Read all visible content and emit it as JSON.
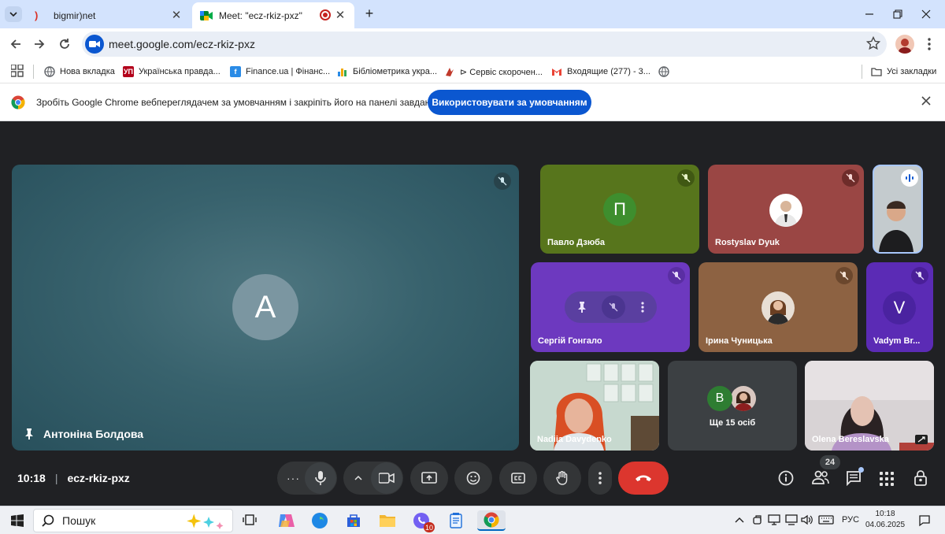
{
  "tabs": [
    {
      "title": "bigmir)net",
      "favicon": "bigmir-icon"
    },
    {
      "title": "Meet: \"ecz-rkiz-pxz\"",
      "favicon": "meet-icon",
      "recording": true
    }
  ],
  "address_bar": {
    "url": "meet.google.com/ecz-rkiz-pxz"
  },
  "bookmarks": {
    "items": [
      {
        "label": "Нова вкладка",
        "icon": "globe-icon",
        "color": "#5f6368"
      },
      {
        "label": "Українська правда...",
        "icon": "up-icon",
        "color": "#b3001b"
      },
      {
        "label": "Finance.ua | Фінанс...",
        "icon": "finance-icon",
        "color": "#2a8be6"
      },
      {
        "label": "Бібліометрика укра...",
        "icon": "bars-icon",
        "color": "#f2a900"
      },
      {
        "label": "⊳ Сервіс скорочен...",
        "icon": "service-icon",
        "color": "#c0392b"
      },
      {
        "label": "Входящие (277) - 3...",
        "icon": "gmail-icon",
        "color": "#ea4335"
      }
    ],
    "all_bookmarks": "Усі закладки"
  },
  "infobar": {
    "message": "Зробіть Google Chrome вебпереглядачем за умовчанням і закріпіть його на панелі завдань",
    "button": "Використовувати за умовчанням"
  },
  "meet": {
    "main_tile": {
      "name": "Антоніна Болдова",
      "initial": "A"
    },
    "tiles": [
      {
        "name": "Павло Дзюба",
        "initial": "П",
        "avatar_color": "#3e8e2e"
      },
      {
        "name": "Rostyslav Dyuk"
      },
      {
        "name": ""
      },
      {
        "name": "Сергій Гонгало"
      },
      {
        "name": "Ірина Чуницька"
      },
      {
        "name": "Vadym Br...",
        "initial": "V",
        "avatar_color": "#5b2bb5"
      },
      {
        "name": "Nadiia Davydenko"
      },
      {
        "name": "Ще 15 осіб",
        "initial": "B",
        "avatar_color": "#2e7d32"
      },
      {
        "name": "Olena Bereslavska"
      }
    ],
    "time": "10:18",
    "meeting_code": "ecz-rkiz-pxz",
    "participants_count": "24"
  },
  "taskbar": {
    "search_placeholder": "Пошук",
    "language": "РУС",
    "time": "10:18",
    "date": "04.06.2025",
    "viber_badge": "10"
  }
}
